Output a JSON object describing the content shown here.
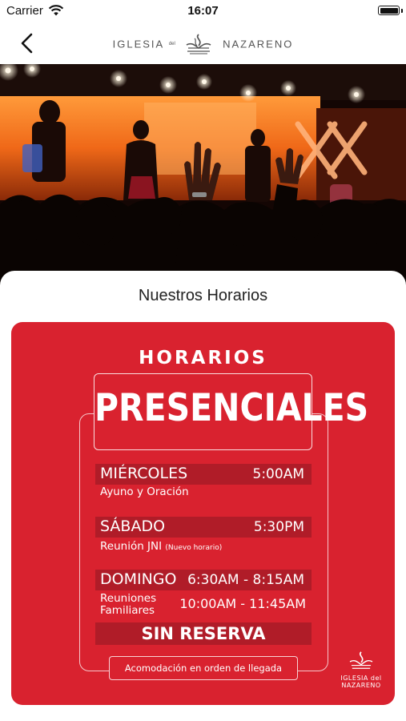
{
  "status_bar": {
    "carrier": "Carrier",
    "time": "16:07"
  },
  "nav": {
    "logo_left": "IGLESIA",
    "logo_del": "del",
    "logo_right": "NAZARENO"
  },
  "section_title": "Nuestros Horarios",
  "card": {
    "heading_top": "HORARIOS",
    "heading_main": "PRESENCIALES",
    "schedule": [
      {
        "day": "MIÉRCOLES",
        "time": "5:00AM",
        "subtitle": "Ayuno y Oración"
      },
      {
        "day": "SÁBADO",
        "time": "5:30PM",
        "subtitle": "Reunión JNI",
        "note": "(Nuevo horario)"
      },
      {
        "day": "DOMINGO",
        "time": "6:30AM - 8:15AM",
        "subtitle_line1": "Reuniones",
        "subtitle_line2": "Familiares",
        "time2": "10:00AM - 11:45AM"
      }
    ],
    "no_reservation": "SIN RESERVA",
    "footer": "Acomodación en orden de llegada",
    "logo_line1": "IGLESIA del",
    "logo_line2": "NAZARENO"
  },
  "colors": {
    "card_red": "#d9222f",
    "bar_red": "#b01c28"
  }
}
